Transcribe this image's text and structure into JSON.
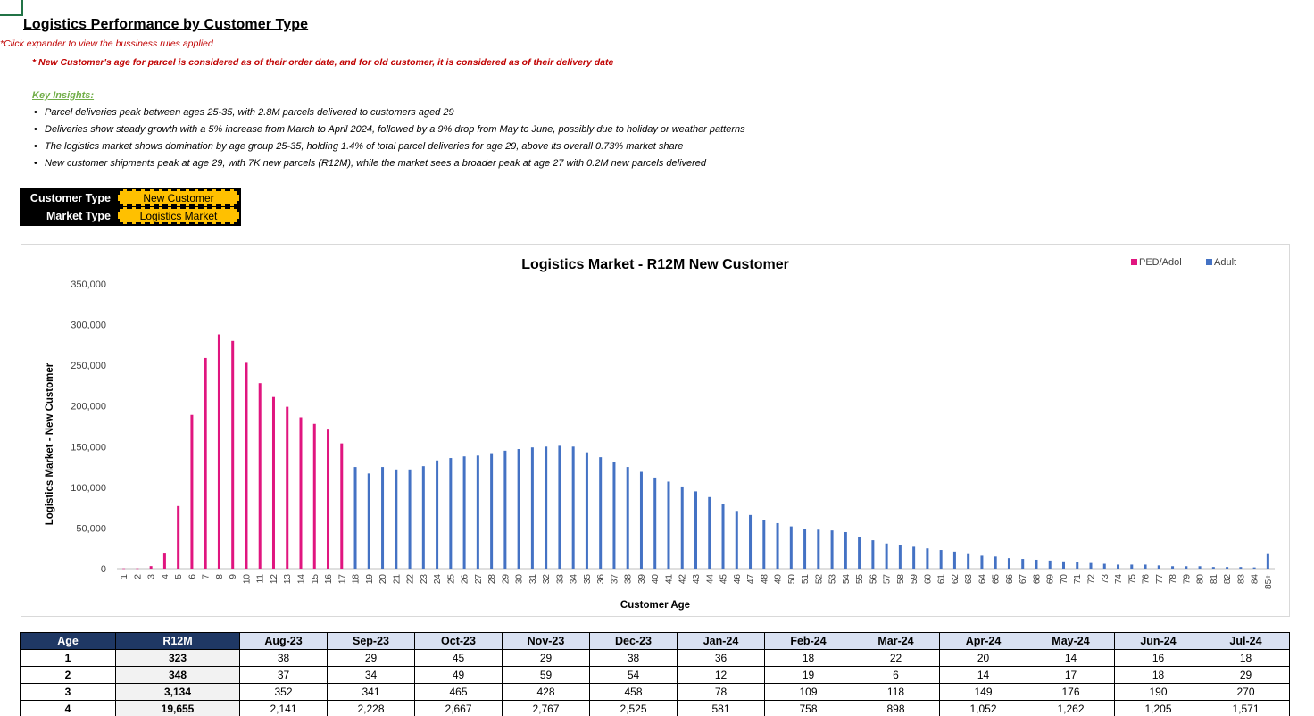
{
  "page": {
    "title": "Logistics Performance by Customer Type",
    "note_expander": "*Click expander to view the bussiness rules applied",
    "note_rule": "* New Customer's age for parcel is considered as of their order date, and for old customer, it is considered as of their delivery date",
    "insights_heading": "Key Insights:",
    "insights": [
      "Parcel deliveries peak between ages 25-35, with 2.8M parcels delivered to customers aged 29",
      "Deliveries show steady growth with a 5% increase from March to April 2024, followed by a 9% drop from May to June, possibly due to holiday or weather patterns",
      "The logistics market shows domination by age group 25-35, holding 1.4% of total parcel deliveries for age 29, above its overall 0.73% market share",
      "New customer shipments peak at age 29, with 7K new parcels (R12M), while the market sees a broader peak at age 27 with 0.2M new parcels delivered"
    ]
  },
  "filters": {
    "customer_type_label": "Customer Type",
    "customer_type_value": "New Customer",
    "market_type_label": "Market Type",
    "market_type_value": "Logistics Market"
  },
  "colors": {
    "ped": "#e0157f",
    "adult": "#4472c4",
    "header_dark": "#1f3864",
    "header_light": "#d9e1f2"
  },
  "chart_data": {
    "type": "bar",
    "title": "Logistics Market - R12M New Customer",
    "xlabel": "Customer Age",
    "ylabel": "Logistics Market - New Customer",
    "ylim": [
      0,
      350000
    ],
    "yticks": [
      "0",
      "50,000",
      "100,000",
      "150,000",
      "200,000",
      "250,000",
      "300,000",
      "350,000"
    ],
    "ytick_values": [
      0,
      50000,
      100000,
      150000,
      200000,
      250000,
      300000,
      350000
    ],
    "legend": [
      {
        "name": "PED/Adol",
        "color": "#e0157f"
      },
      {
        "name": "Adult",
        "color": "#4472c4"
      }
    ],
    "legend_position": "top-right",
    "categories": [
      "1",
      "2",
      "3",
      "4",
      "5",
      "6",
      "7",
      "8",
      "9",
      "10",
      "11",
      "12",
      "13",
      "14",
      "15",
      "16",
      "17",
      "18",
      "19",
      "20",
      "21",
      "22",
      "23",
      "24",
      "25",
      "26",
      "27",
      "28",
      "29",
      "30",
      "31",
      "32",
      "33",
      "34",
      "35",
      "36",
      "37",
      "38",
      "39",
      "40",
      "41",
      "42",
      "43",
      "44",
      "45",
      "46",
      "47",
      "48",
      "49",
      "50",
      "51",
      "52",
      "53",
      "54",
      "55",
      "56",
      "57",
      "58",
      "59",
      "60",
      "61",
      "62",
      "63",
      "64",
      "65",
      "66",
      "67",
      "68",
      "69",
      "70",
      "71",
      "72",
      "73",
      "74",
      "75",
      "76",
      "77",
      "78",
      "79",
      "80",
      "81",
      "82",
      "83",
      "84",
      "85+"
    ],
    "series_index": [
      0,
      0,
      0,
      0,
      0,
      0,
      0,
      0,
      0,
      0,
      0,
      0,
      0,
      0,
      0,
      0,
      0,
      1,
      1,
      1,
      1,
      1,
      1,
      1,
      1,
      1,
      1,
      1,
      1,
      1,
      1,
      1,
      1,
      1,
      1,
      1,
      1,
      1,
      1,
      1,
      1,
      1,
      1,
      1,
      1,
      1,
      1,
      1,
      1,
      1,
      1,
      1,
      1,
      1,
      1,
      1,
      1,
      1,
      1,
      1,
      1,
      1,
      1,
      1,
      1,
      1,
      1,
      1,
      1,
      1,
      1,
      1,
      1,
      1,
      1,
      1,
      1,
      1,
      1,
      1,
      1,
      1,
      1,
      1,
      1
    ],
    "values": [
      323,
      348,
      3134,
      19655,
      77000,
      189000,
      259000,
      288000,
      280000,
      253000,
      228000,
      211000,
      199000,
      186000,
      178000,
      171000,
      154000,
      125000,
      117000,
      125000,
      122000,
      122000,
      126000,
      133000,
      136000,
      138000,
      139000,
      142000,
      145000,
      147000,
      149000,
      150000,
      151000,
      150000,
      143000,
      137000,
      131000,
      125000,
      119000,
      112000,
      107000,
      101000,
      95000,
      88000,
      79000,
      71000,
      66000,
      60000,
      56000,
      52000,
      49000,
      48000,
      47000,
      45000,
      39000,
      35000,
      31000,
      29000,
      27000,
      25000,
      23000,
      21000,
      19000,
      16000,
      15000,
      13000,
      12000,
      11000,
      10000,
      9000,
      8000,
      7000,
      6000,
      5000,
      5000,
      5000,
      4000,
      3000,
      3000,
      3000,
      2000,
      2000,
      2000,
      1500,
      19000
    ]
  },
  "table": {
    "headers": [
      "Age",
      "R12M",
      "Aug-23",
      "Sep-23",
      "Oct-23",
      "Nov-23",
      "Dec-23",
      "Jan-24",
      "Feb-24",
      "Mar-24",
      "Apr-24",
      "May-24",
      "Jun-24",
      "Jul-24"
    ],
    "rows": [
      [
        "1",
        "323",
        "38",
        "29",
        "45",
        "29",
        "38",
        "36",
        "18",
        "22",
        "20",
        "14",
        "16",
        "18"
      ],
      [
        "2",
        "348",
        "37",
        "34",
        "49",
        "59",
        "54",
        "12",
        "19",
        "6",
        "14",
        "17",
        "18",
        "29"
      ],
      [
        "3",
        "3,134",
        "352",
        "341",
        "465",
        "428",
        "458",
        "78",
        "109",
        "118",
        "149",
        "176",
        "190",
        "270"
      ],
      [
        "4",
        "19,655",
        "2,141",
        "2,228",
        "2,667",
        "2,767",
        "2,525",
        "581",
        "758",
        "898",
        "1,052",
        "1,262",
        "1,205",
        "1,571"
      ]
    ]
  }
}
